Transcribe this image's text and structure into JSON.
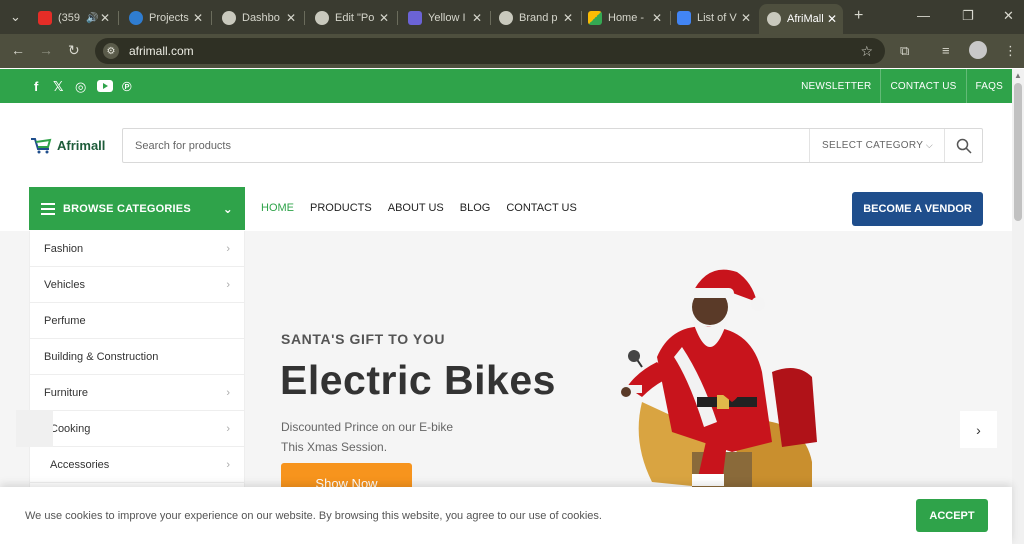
{
  "browser": {
    "tabs": [
      {
        "title": "(359",
        "fav_color": "#e52d27"
      },
      {
        "title": "Projects",
        "fav_color": "#2f7dd1"
      },
      {
        "title": "Dashbo",
        "fav_color": "#c9c9bd"
      },
      {
        "title": "Edit \"Po",
        "fav_color": "#c9c9bd"
      },
      {
        "title": "Yellow I",
        "fav_color": "#6b63d6"
      },
      {
        "title": "Brand p",
        "fav_color": "#c9c9bd"
      },
      {
        "title": "Home -",
        "fav_color": "#fbbc05"
      },
      {
        "title": "List of V",
        "fav_color": "#4285f4"
      },
      {
        "title": "AfriMall",
        "fav_color": "#c9c9bd"
      }
    ],
    "url": "afrimall.com"
  },
  "topbar": {
    "links": [
      "NEWSLETTER",
      "CONTACT US",
      "FAQS"
    ],
    "color": "#2fa34a"
  },
  "header": {
    "logo_text": "Afrimall",
    "search_placeholder": "Search for products",
    "category_label": "SELECT CATEGORY"
  },
  "nav": {
    "browse_label": "BROWSE CATEGORIES",
    "items": [
      "HOME",
      "PRODUCTS",
      "ABOUT US",
      "BLOG",
      "CONTACT US"
    ],
    "vendor_label": "BECOME A VENDOR",
    "vendor_color": "#1f4e8c"
  },
  "categories": [
    "Fashion",
    "Vehicles",
    "Perfume",
    "Building & Construction",
    "Furniture",
    "Cooking",
    "Accessories"
  ],
  "hero": {
    "kicker": "SANTA'S GIFT TO YOU",
    "title": "Electric Bikes",
    "subtitle_line1": "Discounted Prince on our E-bike",
    "subtitle_line2": "This Xmas Session.",
    "button": "Show Now",
    "button_color": "#f7941d"
  },
  "cookie": {
    "message": "We use cookies to improve your experience on our website. By browsing this website, you agree to our use of cookies.",
    "accept": "ACCEPT"
  }
}
